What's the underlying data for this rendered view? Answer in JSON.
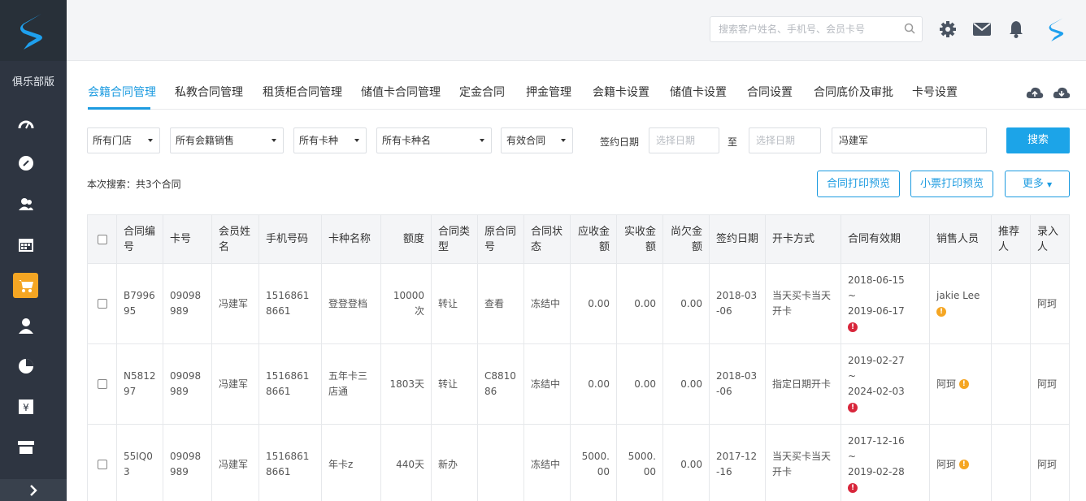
{
  "sidebar": {
    "club_label": "俱乐部版",
    "icons": [
      "dashboard-icon",
      "compass-icon",
      "members-icon",
      "calendar-icon",
      "cart-icon",
      "user-icon",
      "pie-chart-icon",
      "finance-icon",
      "store-icon"
    ],
    "active_icon": "cart-icon",
    "accent_color": "#f5a623"
  },
  "topbar": {
    "search_placeholder": "搜索客户姓名、手机号、会员卡号"
  },
  "tabs": [
    {
      "label": "会籍合同管理",
      "active": true
    },
    {
      "label": "私教合同管理"
    },
    {
      "label": "租赁柜合同管理"
    },
    {
      "label": "储值卡合同管理"
    },
    {
      "label": "定金合同"
    },
    {
      "label": "押金管理"
    },
    {
      "label": "会籍卡设置"
    },
    {
      "label": "储值卡设置"
    },
    {
      "label": "合同设置"
    },
    {
      "label": "合同底价及审批"
    },
    {
      "label": "卡号设置"
    }
  ],
  "filters": {
    "store": "所有门店",
    "sales": "所有会籍销售",
    "card_type": "所有卡种",
    "card_name": "所有卡种名",
    "status": "有效合同",
    "sign_date_label": "签约日期",
    "date_from_placeholder": "选择日期",
    "to_label": "至",
    "date_to_placeholder": "选择日期",
    "keyword": "冯建军",
    "search_button": "搜索"
  },
  "summary": "本次搜索：共3个合同",
  "actions": {
    "print_contract": "合同打印预览",
    "print_receipt": "小票打印预览",
    "more": "更多"
  },
  "table": {
    "headers": {
      "contract_no": "合同编号",
      "card_no": "卡号",
      "member_name": "会员姓名",
      "phone": "手机号码",
      "card_type_name": "卡种名称",
      "amount": "额度",
      "contract_type": "合同类型",
      "original_no": "原合同号",
      "contract_status": "合同状态",
      "receivable": "应收金额",
      "received": "实收金额",
      "owed": "尚欠金额",
      "sign_date": "签约日期",
      "open_method": "开卡方式",
      "validity": "合同有效期",
      "salesperson": "销售人员",
      "referrer": "推荐人",
      "entered_by": "录入人"
    },
    "rows": [
      {
        "contract_no": "B799695",
        "card_no": "09098989",
        "member_name": "冯建军",
        "phone": "15168618661",
        "card_type_name": "登登登档",
        "amount": "10000次",
        "contract_type": "转让",
        "original_no": "查看",
        "contract_status": "冻结中",
        "receivable": "0.00",
        "received": "0.00",
        "owed": "0.00",
        "sign_date": "2018-03-06",
        "open_method": "当天买卡当天开卡",
        "validity_start": "2018-06-15",
        "validity_sep": "~",
        "validity_end": "2019-06-17",
        "salesperson": "jakie Lee",
        "referrer": "",
        "entered_by": "阿珂"
      },
      {
        "contract_no": "N581297",
        "card_no": "09098989",
        "member_name": "冯建军",
        "phone": "15168618661",
        "card_type_name": "五年卡三店通",
        "amount": "1803天",
        "contract_type": "转让",
        "original_no": "C881086",
        "contract_status": "冻结中",
        "receivable": "0.00",
        "received": "0.00",
        "owed": "0.00",
        "sign_date": "2018-03-06",
        "open_method": "指定日期开卡",
        "validity_start": "2019-02-27",
        "validity_sep": "~",
        "validity_end": "2024-02-03",
        "salesperson": "阿珂",
        "referrer": "",
        "entered_by": "阿珂"
      },
      {
        "contract_no": "55IQ03",
        "card_no": "09098989",
        "member_name": "冯建军",
        "phone": "15168618661",
        "card_type_name": "年卡z",
        "amount": "440天",
        "contract_type": "新办",
        "original_no": "",
        "contract_status": "冻结中",
        "receivable": "5000.00",
        "received": "5000.00",
        "owed": "0.00",
        "sign_date": "2017-12-16",
        "open_method": "当天买卡当天开卡",
        "validity_start": "2017-12-16",
        "validity_sep": "~",
        "validity_end": "2019-02-28",
        "salesperson": "阿珂",
        "referrer": "",
        "entered_by": "阿珂"
      }
    ]
  },
  "colors": {
    "primary": "#1c9be0",
    "frozen": "#c7253a",
    "warning": "#f5a623",
    "error": "#d8263b",
    "sidebar_bg": "#2e3541"
  }
}
